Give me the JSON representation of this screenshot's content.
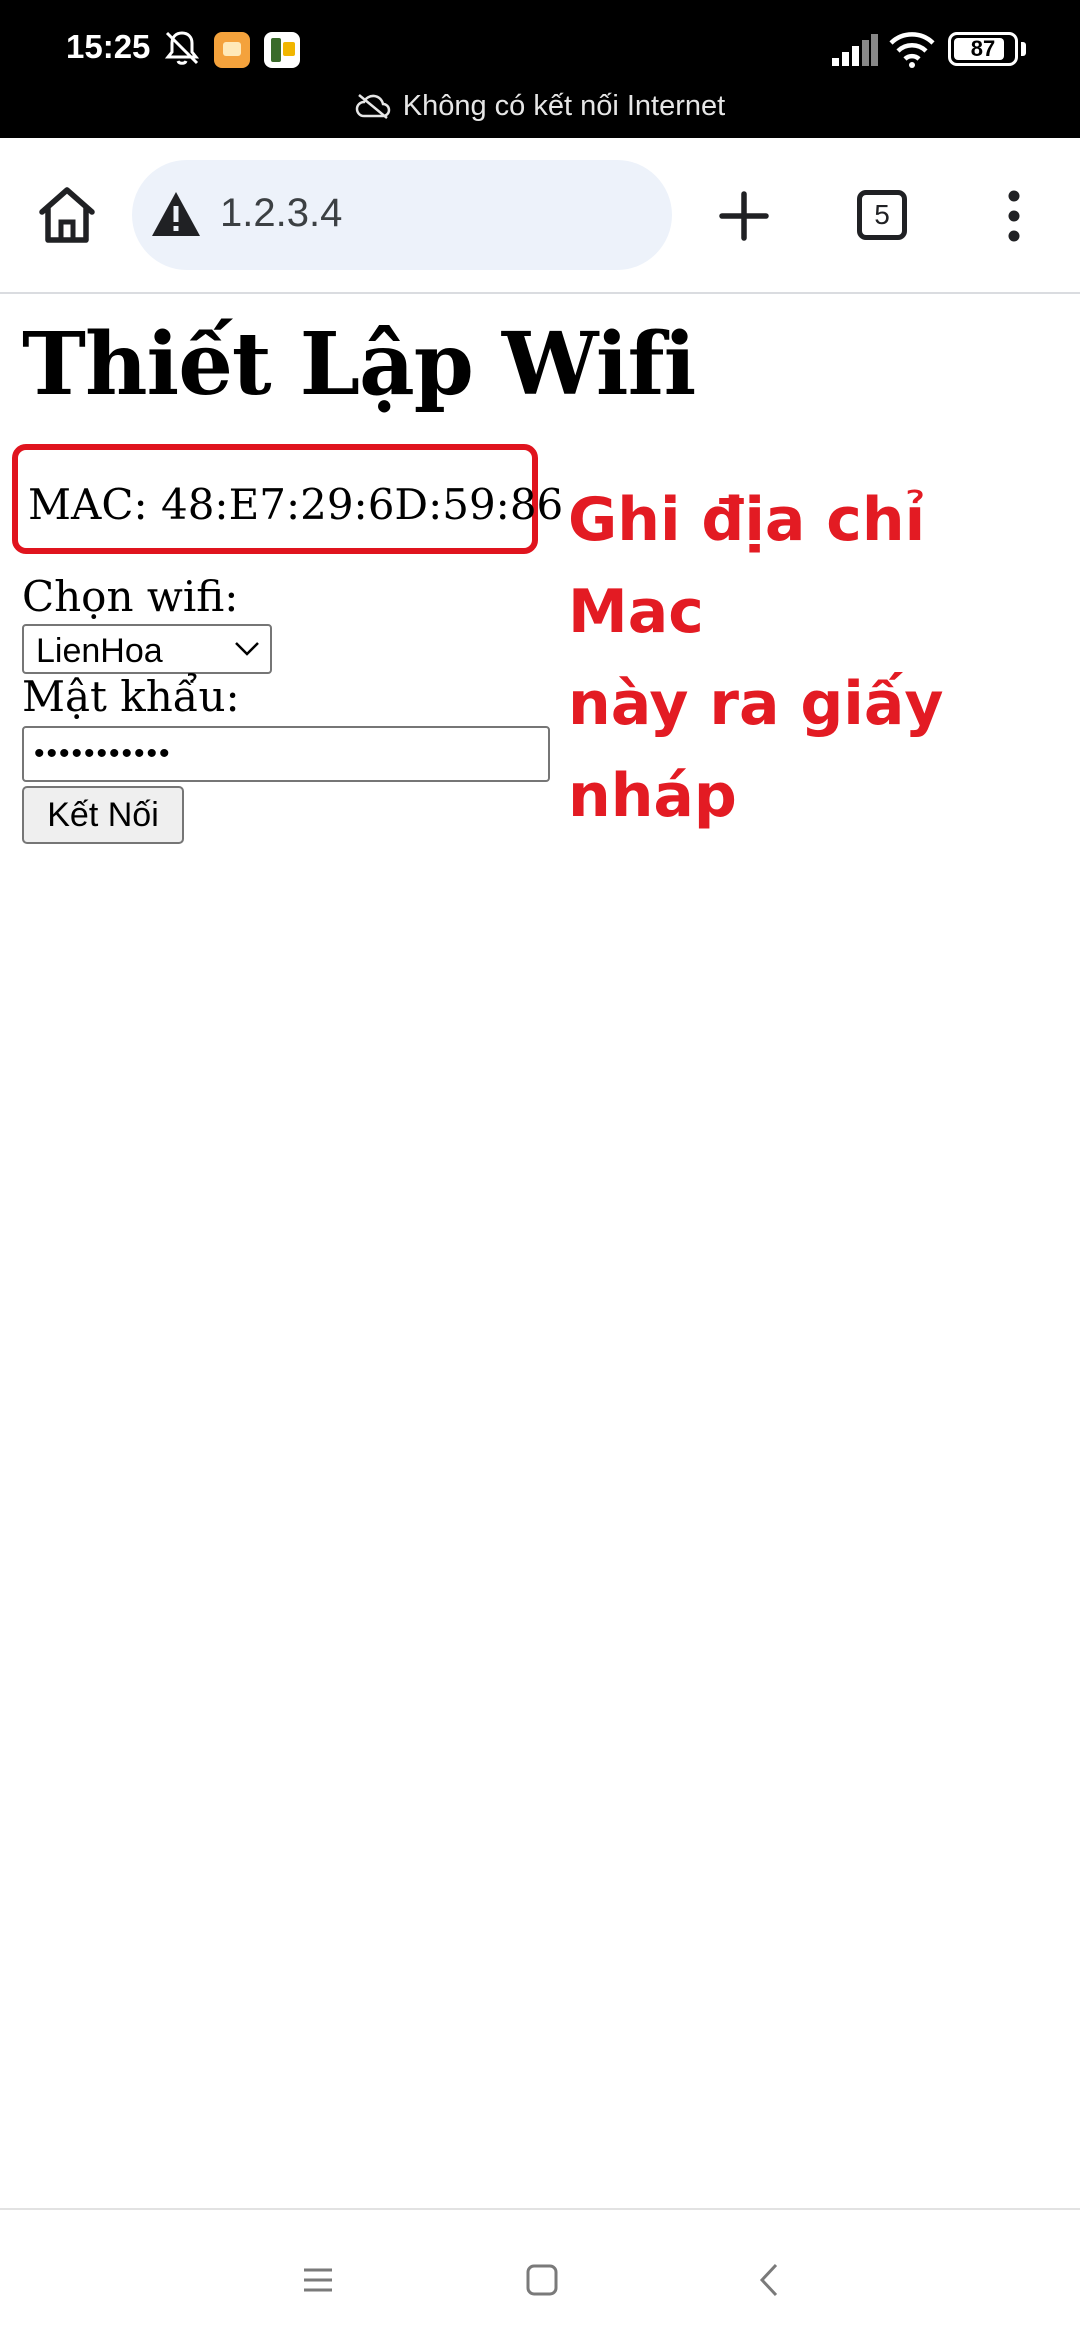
{
  "status_bar": {
    "time": "15:25",
    "battery": "87",
    "battery_level": 0.87,
    "connectivity_message": "Không có kết nối Internet",
    "icons": [
      "notifications-muted-icon",
      "app-notification-icon",
      "app-notification-icon",
      "signal-icon",
      "wifi-icon",
      "battery-icon",
      "cloud-off-icon"
    ]
  },
  "browser": {
    "url": "1.2.3.4",
    "tab_count": "5",
    "icons": [
      "home-icon",
      "insecure-warning-icon",
      "new-tab-icon",
      "tab-switcher-icon",
      "overflow-menu-icon"
    ]
  },
  "page": {
    "title": "Thiết Lập Wifi",
    "mac_text": "MAC: 48:E7:29:6D:59:86",
    "wifi_label": "Chọn wifi:",
    "wifi_selected": "LienHoa",
    "password_label": "Mật khẩu:",
    "password_value": "•••••••••••",
    "connect_button": "Kết Nối"
  },
  "annotation": {
    "lines": [
      "Ghi địa chỉ Mac",
      "này ra giấy",
      "nháp"
    ],
    "color": "#e31b23"
  },
  "nav_bar": {
    "icons": [
      "menu-icon",
      "home-icon",
      "back-icon"
    ]
  }
}
